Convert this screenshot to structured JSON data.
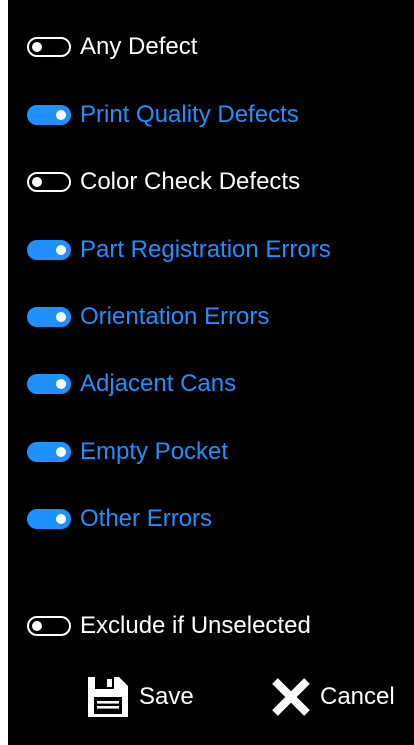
{
  "filters": [
    {
      "label": "Any Defect",
      "state": "off"
    },
    {
      "label": "Print Quality Defects",
      "state": "on"
    },
    {
      "label": "Color Check Defects",
      "state": "off"
    },
    {
      "label": "Part Registration Errors",
      "state": "on"
    },
    {
      "label": "Orientation Errors",
      "state": "on"
    },
    {
      "label": "Adjacent Cans",
      "state": "on"
    },
    {
      "label": "Empty Pocket",
      "state": "on"
    },
    {
      "label": "Other Errors",
      "state": "on"
    }
  ],
  "exclude_option": {
    "label": "Exclude if Unselected",
    "state": "off"
  },
  "actions": {
    "save_label": "Save",
    "cancel_label": "Cancel"
  },
  "icons": {
    "save": "floppy-disk-icon",
    "cancel": "close-x-icon"
  },
  "colors": {
    "background": "#000000",
    "active": "#1e90ff",
    "inactive": "#ffffff"
  }
}
